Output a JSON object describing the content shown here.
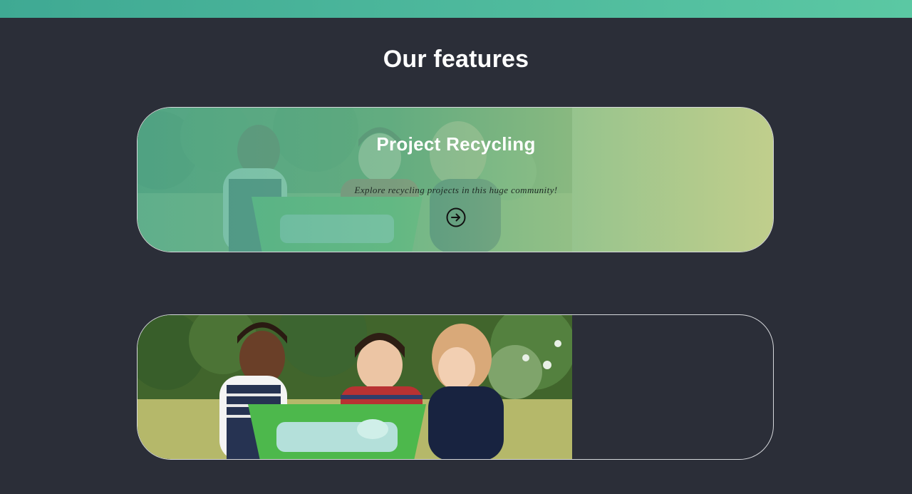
{
  "section": {
    "title": "Our features"
  },
  "cards": [
    {
      "title": "Project Recycling",
      "description": "Explore recycling projects in this huge community!",
      "action_icon": "arrow-right-circle-icon"
    },
    {
      "title": "",
      "description": ""
    }
  ],
  "colors": {
    "background": "#2b2e38",
    "topbar_start": "#3fa993",
    "topbar_end": "#5bc8a3",
    "card_gradient_start": "#54b096",
    "card_gradient_end": "#c2cc8c",
    "card_border": "#d6d8dc"
  }
}
